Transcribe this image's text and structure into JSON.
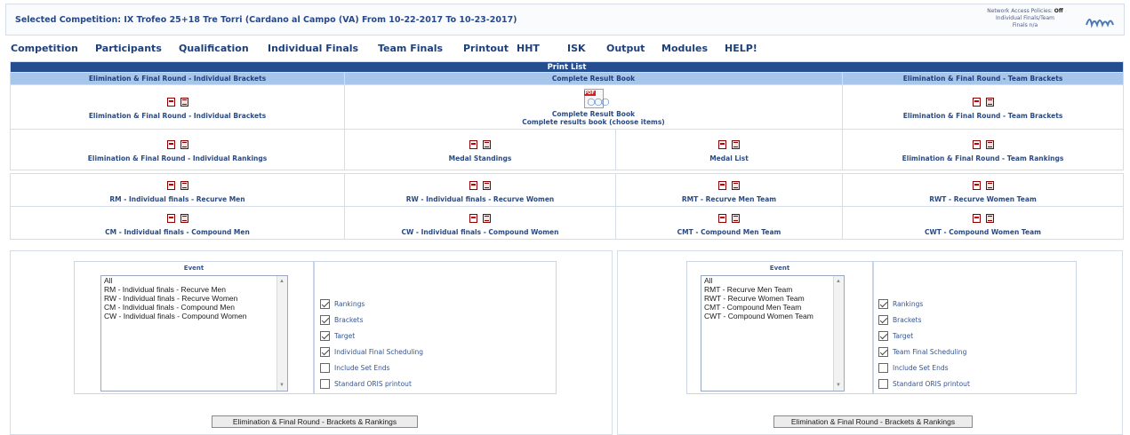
{
  "header": {
    "title": "Selected Competition: IX Trofeo 25+18 Tre Torri (Cardano al Campo (VA) From 10-22-2017 To 10-23-2017)",
    "access_label": "Network Access Policies:",
    "access_value": "Off",
    "finals_label": "Individual Finals/Team",
    "finals_value": "Finals n/a"
  },
  "menu": [
    "Competition",
    "Participants",
    "Qualification",
    "Individual Finals",
    "Team Finals",
    "Printout",
    "HHT",
    "ISK",
    "Output",
    "Modules",
    "HELP!"
  ],
  "print_list": {
    "title": "Print List",
    "col_headers": {
      "individual": "Elimination & Final Round - Individual Brackets",
      "book": "Complete Result Book",
      "team": "Elimination & Final Round - Team Brackets"
    },
    "row1": {
      "individual": "Elimination & Final Round - Individual Brackets",
      "book_title": "Complete Result Book",
      "book_sub": "Complete results book (choose items)",
      "team": "Elimination & Final Round - Team Brackets"
    },
    "row2": {
      "individual": "Elimination & Final Round - Individual Rankings",
      "medal_standings": "Medal Standings",
      "medal_list": "Medal List",
      "team": "Elimination & Final Round - Team Rankings"
    },
    "events": {
      "rm": "RM - Individual finals - Recurve Men",
      "rw": "RW - Individual finals - Recurve Women",
      "rmt": "RMT - Recurve Men Team",
      "rwt": "RWT - Recurve Women Team",
      "cm": "CM - Individual finals - Compound Men",
      "cw": "CW - Individual finals - Compound Women",
      "cmt": "CMT - Compound Men Team",
      "cwt": "CWT - Compound Women Team"
    }
  },
  "individual_panel": {
    "event_label": "Event",
    "options": [
      "All",
      "RM - Individual finals - Recurve Men",
      "RW - Individual finals - Recurve Women",
      "CM - Individual finals - Compound Men",
      "CW - Individual finals - Compound Women"
    ],
    "checks": [
      {
        "label": "Rankings",
        "checked": true
      },
      {
        "label": "Brackets",
        "checked": true
      },
      {
        "label": "Target",
        "checked": true
      },
      {
        "label": "Individual Final Scheduling",
        "checked": true
      },
      {
        "label": "Include Set Ends",
        "checked": false
      },
      {
        "label": "Standard ORIS printout",
        "checked": false
      }
    ],
    "button": "Elimination & Final Round - Brackets & Rankings"
  },
  "team_panel": {
    "event_label": "Event",
    "options": [
      "All",
      "RMT - Recurve Men Team",
      "RWT - Recurve Women Team",
      "CMT - Compound Men Team",
      "CWT - Compound Women Team"
    ],
    "checks": [
      {
        "label": "Rankings",
        "checked": true
      },
      {
        "label": "Brackets",
        "checked": true
      },
      {
        "label": "Target",
        "checked": true
      },
      {
        "label": "Team Final Scheduling",
        "checked": true
      },
      {
        "label": "Include Set Ends",
        "checked": false
      },
      {
        "label": "Standard ORIS printout",
        "checked": false
      }
    ],
    "button": "Elimination & Final Round - Brackets & Rankings"
  },
  "icons": {
    "pdf": "pdf-icon",
    "print": "print-preview-icon",
    "book": "result-book-pdf-icon",
    "logo": "ianseo-logo-icon"
  },
  "colors": {
    "title_bar": "#244e8f",
    "subheader": "#a8c6ea",
    "link": "#1d3f7a"
  }
}
